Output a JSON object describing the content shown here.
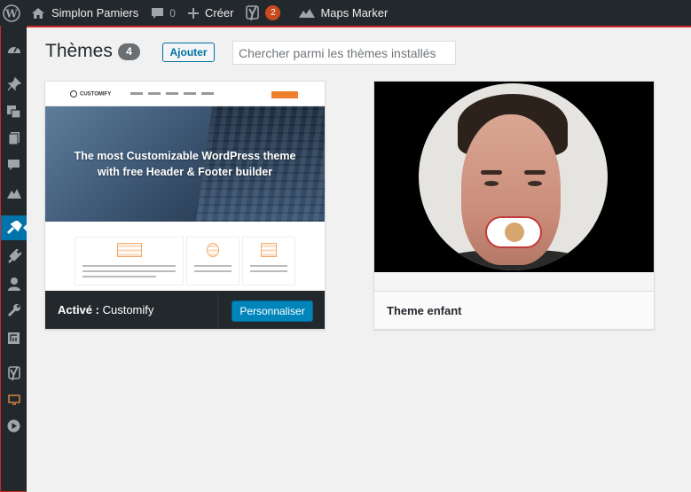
{
  "adminbar": {
    "site_name": "Simplon Pamiers",
    "comments_count": "0",
    "new_label": "Créer",
    "yoast_badge": "2",
    "maps_marker_label": "Maps Marker"
  },
  "page": {
    "title": "Thèmes",
    "theme_count": "4",
    "add_label": "Ajouter",
    "search_placeholder": "Chercher parmi les thèmes installés"
  },
  "themes": [
    {
      "hero_text": "The most Customizable WordPress theme with free Header & Footer builder",
      "logo_text": "CUSTOMIFY",
      "active_label": "Activé :",
      "name": "Customify",
      "action_label": "Personnaliser"
    },
    {
      "name": "Theme enfant"
    }
  ],
  "colors": {
    "adminbar_bg": "#23282d",
    "accent": "#0073aa",
    "primary_button": "#0085ba",
    "badge": "#ca4a1f"
  },
  "sidebar_icons": [
    "dashboard-icon",
    "pin-icon",
    "media-icon",
    "pages-icon",
    "comments-icon",
    "maps-marker-icon",
    "appearance-icon",
    "plugins-icon",
    "users-icon",
    "tools-icon",
    "settings-icon",
    "yoast-icon",
    "slider-icon",
    "play-icon"
  ]
}
